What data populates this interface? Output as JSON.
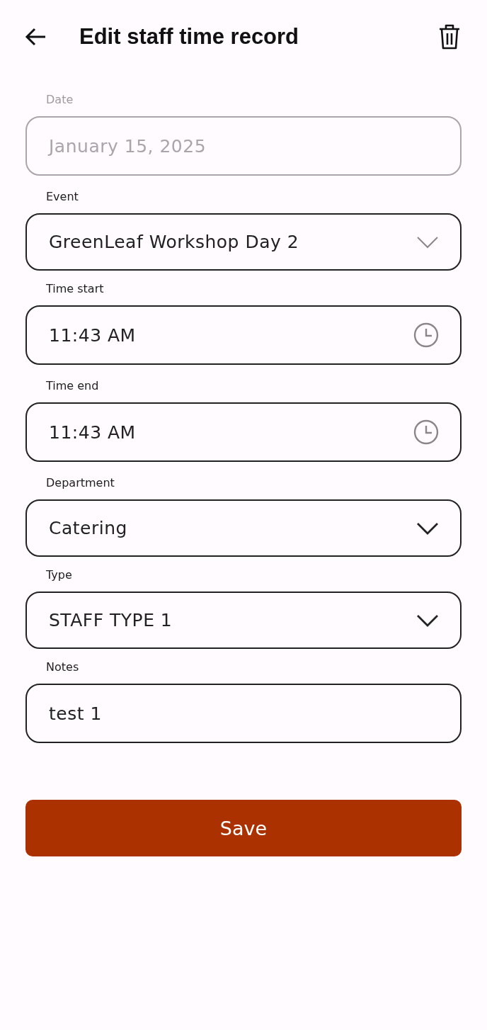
{
  "header": {
    "title": "Edit staff time record"
  },
  "fields": [
    {
      "label": "Date",
      "kind": "date",
      "value": "January 15, 2025",
      "disabled": true
    },
    {
      "label": "Event",
      "kind": "select",
      "value": "GreenLeaf Workshop Day 2",
      "disabled": false
    },
    {
      "label": "Time start",
      "kind": "time",
      "value": "11:43 AM",
      "disabled": false
    },
    {
      "label": "Time end",
      "kind": "time",
      "value": "11:43 AM",
      "disabled": false
    },
    {
      "label": "Department",
      "kind": "select",
      "value": "Catering",
      "disabled": false
    },
    {
      "label": "Type",
      "kind": "select",
      "value": "STAFF TYPE 1",
      "disabled": false
    },
    {
      "label": "Notes",
      "kind": "text",
      "value": "test 1",
      "disabled": false
    }
  ],
  "save_button": {
    "label": "Save"
  }
}
